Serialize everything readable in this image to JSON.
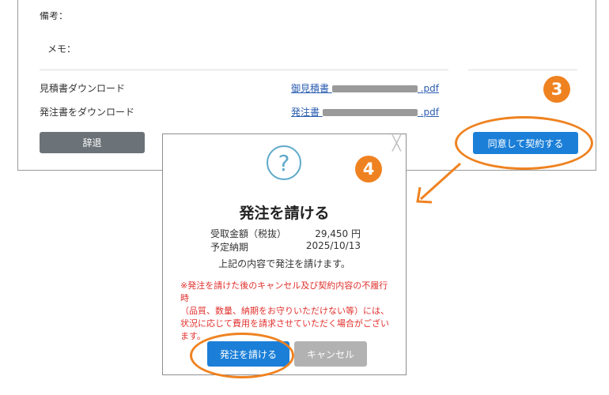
{
  "form": {
    "remarks_label": "備考：",
    "memo_label": "メモ：",
    "quote_download_label": "見積書ダウンロード",
    "quote_file_prefix": "御見積書",
    "quote_file_ext": ".pdf",
    "order_download_label": "発注書をダウンロード",
    "order_file_prefix": "発注書",
    "order_file_ext": ".pdf",
    "decline_button": "辞退",
    "agree_button": "同意して契約する"
  },
  "steps": {
    "step3": "3",
    "step4": "4"
  },
  "modal": {
    "icon": "question-icon",
    "icon_glyph": "?",
    "close_glyph": "╳",
    "title": "発注を請ける",
    "amount_label": "受取金額（税抜）",
    "amount_value": "29,450 円",
    "delivery_label": "予定納期",
    "delivery_value": "2025/10/13",
    "confirm_note": "上記の内容で発注を請けます。",
    "warning": "※発注を請けた後のキャンセル及び契約内容の不履行時\n（品質、数量、納期をお守りいただけない等）には、\n状況に応じて費用を請求させていただく場合がござい\nます。",
    "accept_button": "発注を請ける",
    "cancel_button": "キャンセル"
  },
  "colors": {
    "accent_orange": "#ef8220",
    "primary_blue": "#1b7fd8",
    "warning_red": "#e0302c",
    "link_blue": "#2a5db0"
  }
}
